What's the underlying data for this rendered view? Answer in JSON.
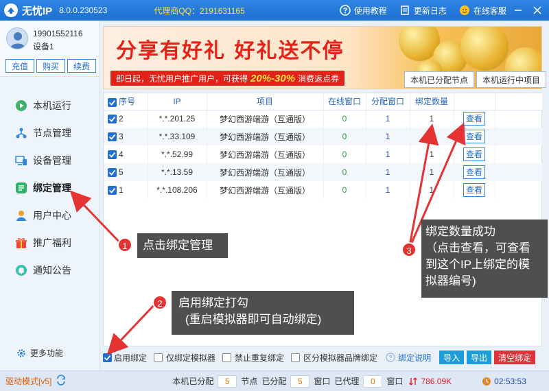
{
  "titlebar": {
    "app_name": "无忧IP",
    "version": "8.0.0.230523",
    "agent_qq": "代理商QQ：2191631165",
    "tutorial": "使用教程",
    "changelog": "更新日志",
    "support": "在线客服"
  },
  "user": {
    "phone": "19901552116",
    "device": "设备1",
    "buttons": [
      "充值",
      "购买",
      "续费"
    ]
  },
  "nav": {
    "items": [
      {
        "label": "本机运行",
        "icon": "play-icon"
      },
      {
        "label": "节点管理",
        "icon": "node-icon"
      },
      {
        "label": "设备管理",
        "icon": "device-icon"
      },
      {
        "label": "绑定管理",
        "icon": "bind-icon",
        "active": true
      },
      {
        "label": "用户中心",
        "icon": "user-icon"
      },
      {
        "label": "推广福利",
        "icon": "gift-icon"
      },
      {
        "label": "通知公告",
        "icon": "bell-icon"
      }
    ],
    "more": "更多功能"
  },
  "banner": {
    "title": "分享有好礼  好礼送不停",
    "sub_prefix": "即日起，无忧用户推广用户，可获得",
    "sub_pct": "20%-30%",
    "sub_suffix": "消费返点券"
  },
  "tabs": [
    "本机已分配节点",
    "本机运行中项目"
  ],
  "table": {
    "headers": [
      "序号",
      "IP",
      "项目",
      "在线窗口",
      "分配窗口",
      "绑定数量",
      ""
    ],
    "rows": [
      {
        "idx": "2",
        "ip": "*.*.201.25",
        "project": "梦幻西游端游（互通版）",
        "online": "0",
        "assigned": "1",
        "count": "1",
        "action": "查看"
      },
      {
        "idx": "3",
        "ip": "*.*.33.109",
        "project": "梦幻西游端游（互通版）",
        "online": "0",
        "assigned": "1",
        "count": "1",
        "action": "查看"
      },
      {
        "idx": "4",
        "ip": "*.*.52.99",
        "project": "梦幻西游端游（互通版）",
        "online": "0",
        "assigned": "1",
        "count": "1",
        "action": "查看"
      },
      {
        "idx": "5",
        "ip": "*.*.13.59",
        "project": "梦幻西游端游（互通版）",
        "online": "0",
        "assigned": "1",
        "count": "1",
        "action": "查看"
      },
      {
        "idx": "1",
        "ip": "*.*.108.206",
        "project": "梦幻西游端游（互通版）",
        "online": "0",
        "assigned": "1",
        "count": "1",
        "action": "查看"
      }
    ]
  },
  "options": {
    "enable_bind": "启用绑定",
    "only_bind_sim": "仅绑定模拟器",
    "no_repeat": "禁止重复绑定",
    "distinguish_brand": "区分模拟器品牌绑定",
    "help": "绑定说明",
    "import": "导入",
    "export": "导出",
    "clear": "清空绑定"
  },
  "status": {
    "drive_mode": "驱动模式[v5]",
    "assigned_label": "本机已分配",
    "assigned_val": "5",
    "node_label": "节点",
    "assigned2_label": "已分配",
    "assigned2_val": "5",
    "window_label": "窗口",
    "proxied_label": "已代理",
    "proxied_val": "0",
    "window2_label": "窗口",
    "speed": "786.09K",
    "time": "02:53:53"
  },
  "annotations": {
    "c1_num": "1",
    "c1_text": "点击绑定管理",
    "c2_num": "2",
    "c2_line1": "启用绑定打勾",
    "c2_line2": "(重启模拟器即可自动绑定)",
    "c3_num": "3",
    "c3_line1": "绑定数量成功",
    "c3_line2": "（点击查看，可查看",
    "c3_line3": "到这个IP上绑定的模",
    "c3_line4": "拟器编号)"
  },
  "colors": {
    "titlebar": "#1e6fd1",
    "accent_red": "#e2231a",
    "online_green": "#2a9d3c"
  }
}
